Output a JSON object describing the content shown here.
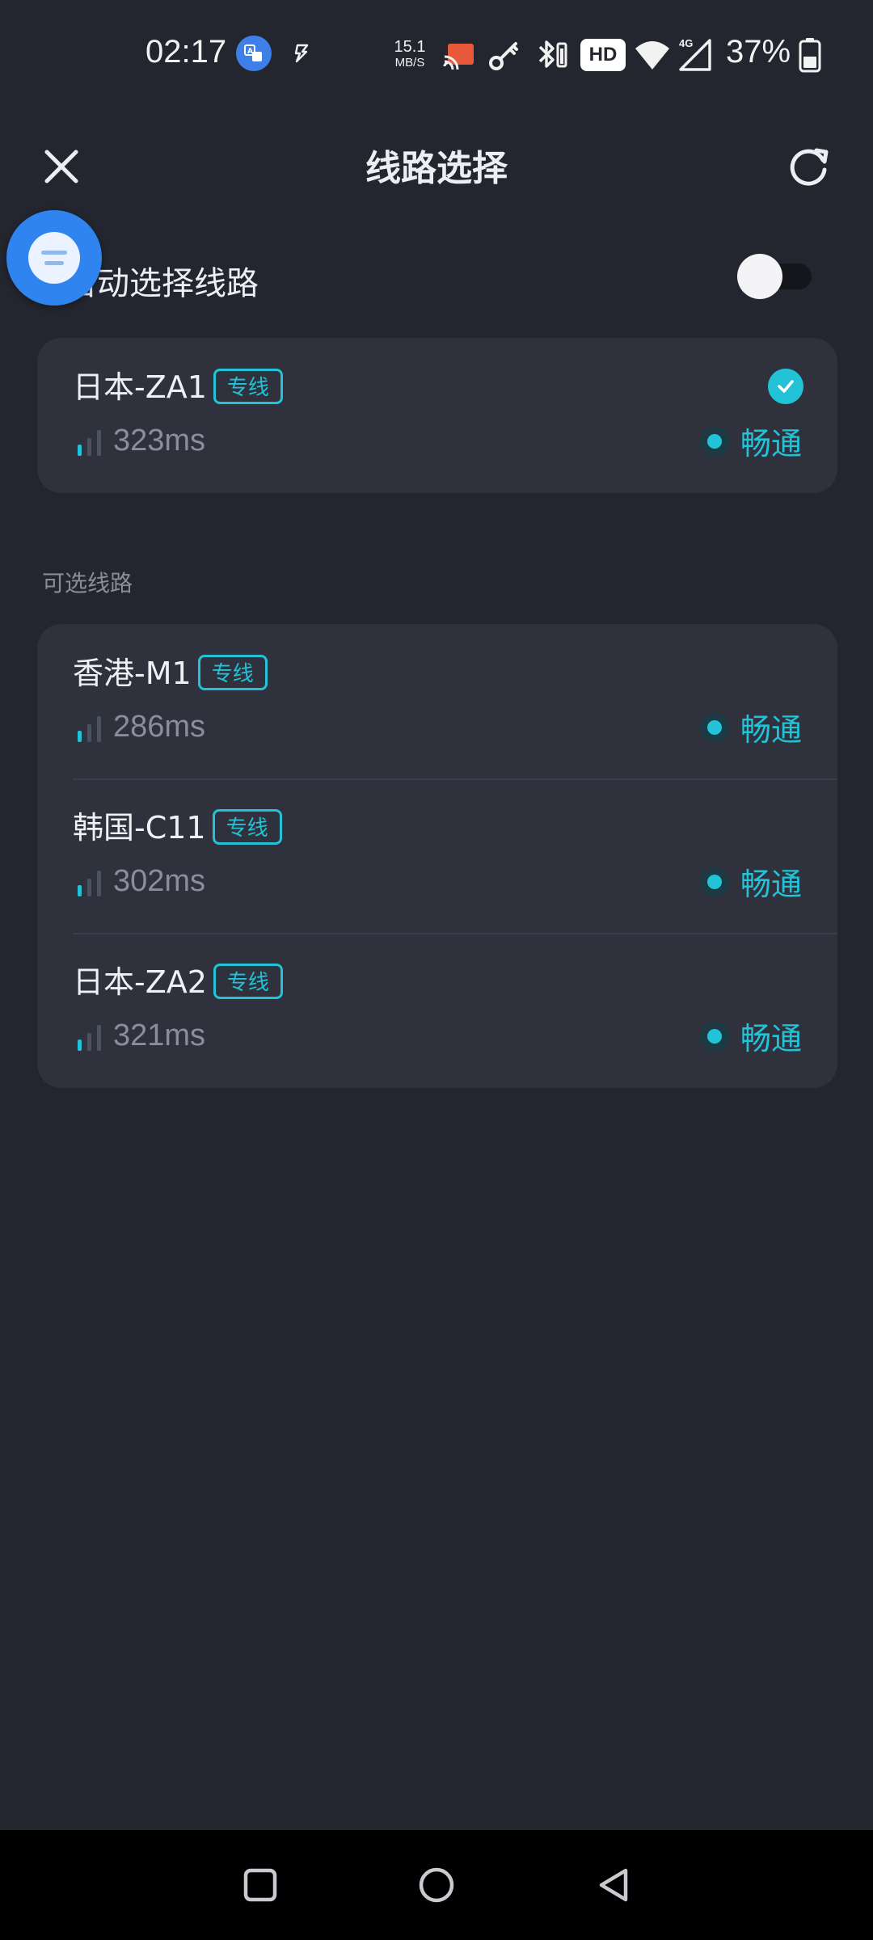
{
  "status_bar": {
    "time": "02:17",
    "translate_icon": "translate-app-icon",
    "net_speed_value": "15.1",
    "net_speed_unit": "MB/S",
    "hd_label": "HD",
    "network_type": "4G",
    "battery_percent": "37%"
  },
  "header": {
    "title": "线路选择",
    "close_icon": "close-icon",
    "refresh_icon": "refresh-icon"
  },
  "auto_select": {
    "label": "自动选择线路",
    "enabled": false
  },
  "current_route": {
    "name": "日本-ZA1",
    "tag": "专线",
    "latency": "323ms",
    "status": "畅通",
    "selected": true
  },
  "available_section": {
    "title": "可选线路",
    "routes": [
      {
        "name": "香港-M1",
        "tag": "专线",
        "latency": "286ms",
        "status": "畅通"
      },
      {
        "name": "韩国-C11",
        "tag": "专线",
        "latency": "302ms",
        "status": "畅通"
      },
      {
        "name": "日本-ZA2",
        "tag": "专线",
        "latency": "321ms",
        "status": "畅通"
      }
    ]
  },
  "colors": {
    "background": "#23252f",
    "card": "#2f313d",
    "accent": "#22c3d6",
    "muted_text": "#8b8e9a",
    "floating_bubble": "#2f84ef"
  },
  "nav_bar": {
    "recents_icon": "square-recents-icon",
    "home_icon": "circle-home-icon",
    "back_icon": "triangle-back-icon"
  }
}
